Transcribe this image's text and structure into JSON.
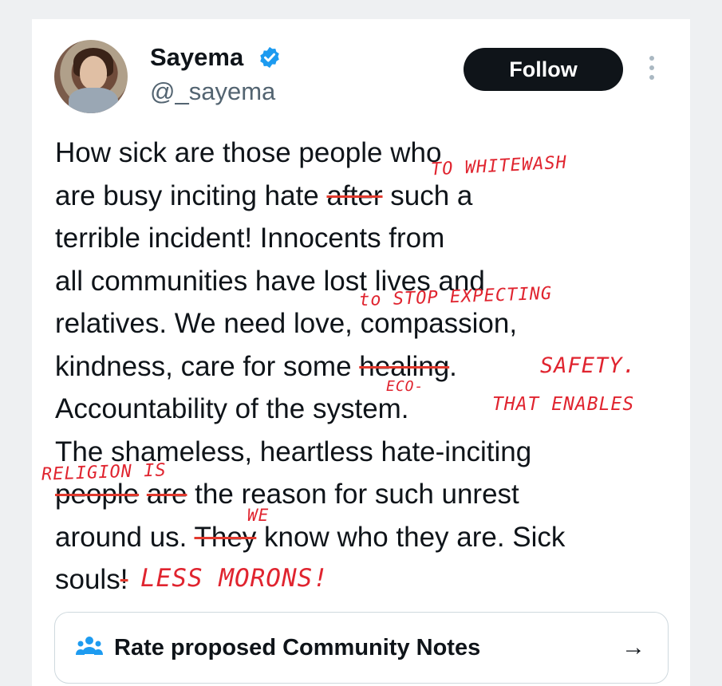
{
  "profile": {
    "name": "Sayema",
    "handle": "@_sayema"
  },
  "actions": {
    "follow_label": "Follow"
  },
  "tweet": {
    "l1": "How sick are those people who",
    "l2a": "are busy inciting hate ",
    "l2b": "after",
    "l2c": " such a",
    "l3": "terrible incident! Innocents from",
    "l4": "all communities have lost lives and",
    "l5": "relatives. We need love, compassion,",
    "l6a": "kindness, care for some ",
    "l6b": "healing",
    "l6c": ".",
    "l7": "Accountability of the system.",
    "l8": "The shameless, heartless hate-inciting",
    "l9a": "people",
    "l9b": " ",
    "l9c": "are",
    "l9d": " the reason for such unrest",
    "l10a": "around us. ",
    "l10b": "They",
    "l10c": " know who they are. Sick",
    "l11a": "souls",
    "l11b": "!"
  },
  "annotations": {
    "a1": "TO WHITEWASH",
    "a2": "to STOP EXPECTING",
    "a3": "SAFETY.",
    "a4": "ECO-",
    "a5": "THAT ENABLES",
    "a6": "RELIGION IS",
    "a7": "WE",
    "a8": "LESS MORONS!"
  },
  "community_notes": {
    "label": "Rate proposed Community Notes",
    "arrow": "→"
  },
  "colors": {
    "accent": "#1d9bf0",
    "annotation_ink": "#e0242f",
    "follow_bg": "#0f1419"
  },
  "icons": [
    "verified-badge-icon",
    "more-options-icon",
    "community-notes-icon",
    "arrow-right-icon"
  ]
}
